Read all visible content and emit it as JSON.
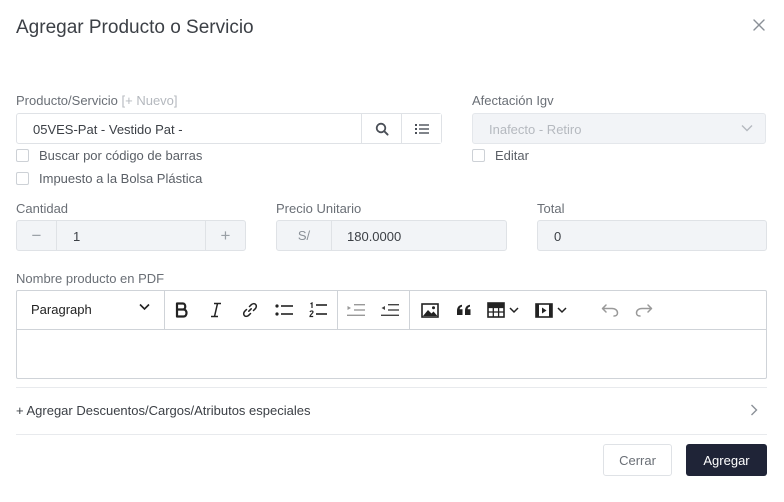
{
  "modal": {
    "title": "Agregar Producto o Servicio",
    "close_icon": "close-icon"
  },
  "product": {
    "label": "Producto/Servicio",
    "new_link": "[+ Nuevo]",
    "value": "05VES-Pat - Vestido Pat -",
    "search_icon": "search-icon",
    "list_icon": "list-icon"
  },
  "afectacion": {
    "label": "Afectación Igv",
    "value": "Inafecto - Retiro"
  },
  "checks": {
    "barcode": "Buscar por código de barras",
    "bolsa": "Impuesto a la Bolsa Plástica",
    "editar": "Editar"
  },
  "cantidad": {
    "label": "Cantidad",
    "value": "1",
    "minus": "−",
    "plus": "+"
  },
  "precio": {
    "label": "Precio Unitario",
    "currency": "S/",
    "value": "180.0000"
  },
  "total": {
    "label": "Total",
    "value": "0"
  },
  "pdf_name": {
    "label": "Nombre producto en PDF",
    "block_format": "Paragraph"
  },
  "accordion": {
    "label": "+ Agregar Descuentos/Cargos/Atributos especiales"
  },
  "footer": {
    "close_label": "Cerrar",
    "add_label": "Agregar"
  },
  "colors": {
    "primary_button": "#1f2437",
    "border": "#dfe2e6",
    "disabled_bg": "#f2f4f7"
  }
}
